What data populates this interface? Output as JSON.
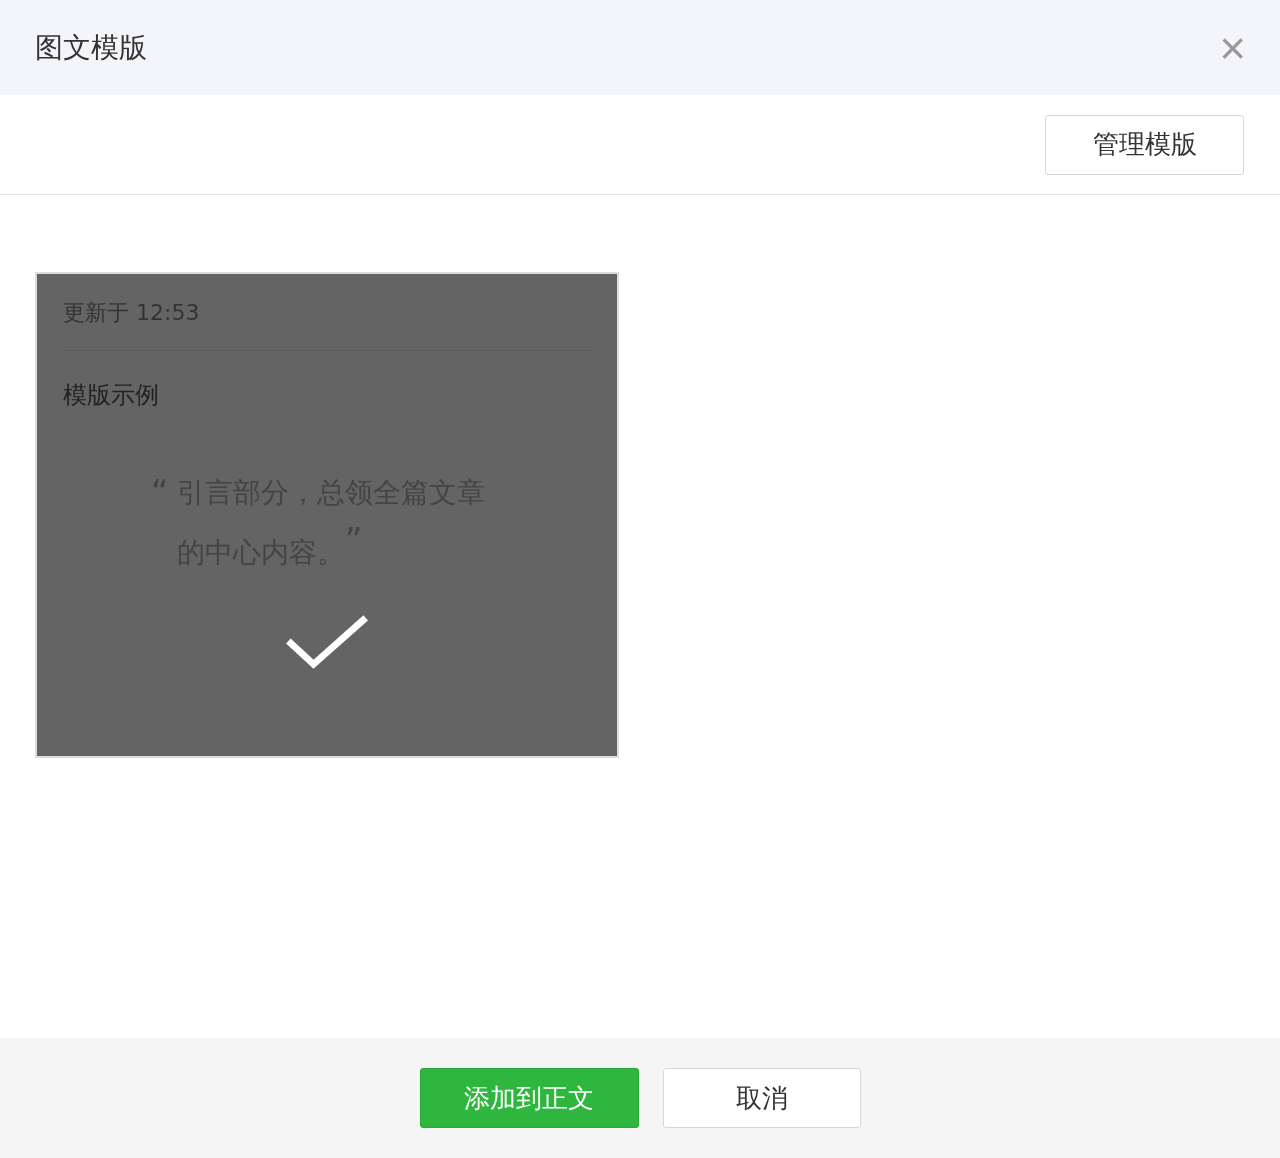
{
  "dialog": {
    "title": "图文模版",
    "close_icon": "×"
  },
  "toolbar": {
    "manage_button": "管理模版"
  },
  "templates": [
    {
      "updated": "更新于 12:53",
      "name": "模版示例",
      "open_quote": "“",
      "quote": "引言部分，总领全篇文章的中心内容。",
      "close_quote": "”",
      "selected": true
    }
  ],
  "footer": {
    "buttons": [
      {
        "label": "添加到正文",
        "kind": "primary"
      },
      {
        "label": "取消",
        "kind": "default"
      }
    ]
  }
}
